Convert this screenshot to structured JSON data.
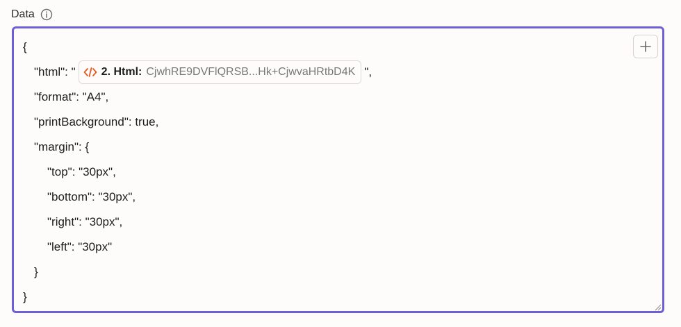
{
  "field": {
    "label": "Data",
    "info_icon": "info-circle-icon",
    "add_icon": "plus-icon",
    "accent_color": "#6e5fd6"
  },
  "editor": {
    "line_1": "{",
    "line_2_before": "\"html\": \"",
    "line_2_pill": {
      "icon": "code-icon",
      "icon_color": "#e8561f",
      "step": "2. Html:",
      "value": "CjwhRE9DVFlQRSB...Hk+CjwvaHRtbD4K"
    },
    "line_2_after": "\",",
    "line_3": "\"format\": \"A4\",",
    "line_4": "\"printBackground\": true,",
    "line_5": "\"margin\": {",
    "line_6": "\"top\": \"30px\",",
    "line_7": "\"bottom\": \"30px\",",
    "line_8": "\"right\": \"30px\",",
    "line_9": "\"left\": \"30px\"",
    "line_10": "}",
    "line_11": "}"
  }
}
